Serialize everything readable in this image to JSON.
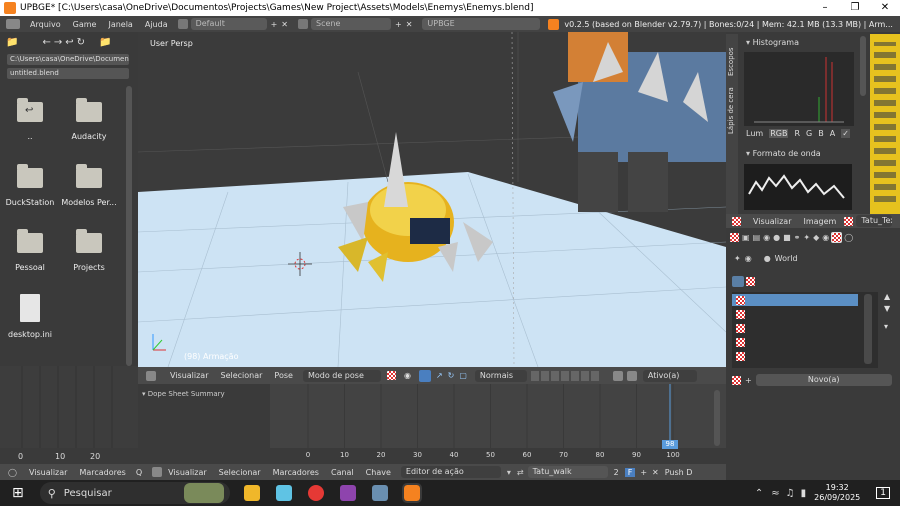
{
  "window": {
    "title": "UPBGE* [C:\\Users\\casa\\OneDrive\\Documentos\\Projects\\Games\\New Project\\Assets\\Models\\Enemys\\Enemys.blend]"
  },
  "infobar": {
    "menus": [
      "Arquivo",
      "Game",
      "Janela",
      "Ajuda"
    ],
    "layout": "Default",
    "scene": "Scene",
    "engine": "UPBGE",
    "stats": "v0.2.5 (based on Blender v2.79.7) | Bones:0/24 | Mem: 42.1 MB (13.3 MB) | Arm..."
  },
  "filebrowser": {
    "path": "C:\\Users\\casa\\OneDrive\\Documen...",
    "file": "untitled.blend",
    "items": [
      "..",
      "Audacity",
      "DuckStation",
      "Modelos Per...",
      "Pessoal",
      "Projects",
      "desktop.ini"
    ]
  },
  "viewport": {
    "view_label": "User Persp",
    "object_label": "(98) Armação"
  },
  "viewport_header": {
    "items": [
      "Visualizar",
      "Selecionar",
      "Pose"
    ],
    "mode": "Modo de pose",
    "shading": "Normais",
    "active": "Ativo(a)"
  },
  "scopes": {
    "tab1": "Escopos",
    "tab2": "Lápis de cera",
    "histogram": "Histograma",
    "channels": [
      "Lum",
      "RGB",
      "R",
      "G",
      "B",
      "A"
    ],
    "waveform": "Formato de onda"
  },
  "image_header": {
    "items": [
      "Visualizar",
      "Imagem"
    ],
    "texture": "Tatu_Textu"
  },
  "properties": {
    "world": "World",
    "new_button": "Novo(a)"
  },
  "dopesheet": {
    "summary": "Dope Sheet Summary",
    "ticks": [
      "0",
      "10",
      "20",
      "30",
      "40",
      "50",
      "60",
      "70",
      "80",
      "90",
      "100"
    ],
    "current_frame": "98"
  },
  "timeline": {
    "ticks": [
      "0",
      "10",
      "20"
    ]
  },
  "bottombar": {
    "left_items": [
      "Visualizar",
      "Marcadores"
    ],
    "items": [
      "Visualizar",
      "Selecionar",
      "Marcadores",
      "Canal",
      "Chave"
    ],
    "editor": "Editor de ação",
    "action": "Tatu_walk",
    "users": "2",
    "fake": "F",
    "push": "Push D"
  },
  "taskbar": {
    "search": "Pesquisar",
    "time": "19:32",
    "date": "26/09/2025",
    "notif": "1"
  }
}
